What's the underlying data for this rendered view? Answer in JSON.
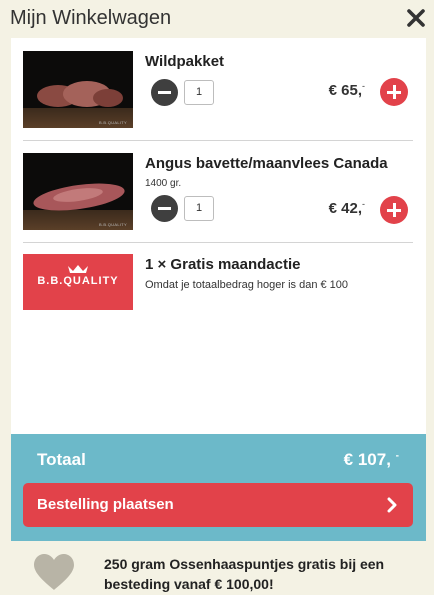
{
  "header": {
    "title": "Mijn Winkelwagen",
    "close_icon": "close-icon"
  },
  "cart": {
    "items": [
      {
        "name": "Wildpakket",
        "subtitle": "",
        "quantity": "1",
        "price": "€ 65,",
        "price_suffix": "-"
      },
      {
        "name": "Angus bavette/maanvlees Canada",
        "subtitle": "1400 gr.",
        "quantity": "1",
        "price": "€ 42,",
        "price_suffix": "-"
      }
    ],
    "promo": {
      "name": "1 × Gratis maandactie",
      "subtitle": "Omdat je totaalbedrag hoger is dan € 100",
      "logo_text": "B.B.QUALITY"
    }
  },
  "totals": {
    "label": "Totaal",
    "amount": "€ 107,",
    "amount_suffix": "-",
    "checkout_label": "Bestelling plaatsen"
  },
  "footer": {
    "message": "250 gram Ossenhaaspuntjes gratis bij een besteding vanaf € 100,00!",
    "icon": "heart-icon"
  },
  "colors": {
    "background": "#f4f2e4",
    "accent_red": "#e2424a",
    "totals_blue": "#6cb9c9",
    "minus_dark": "#3f3f3f"
  }
}
